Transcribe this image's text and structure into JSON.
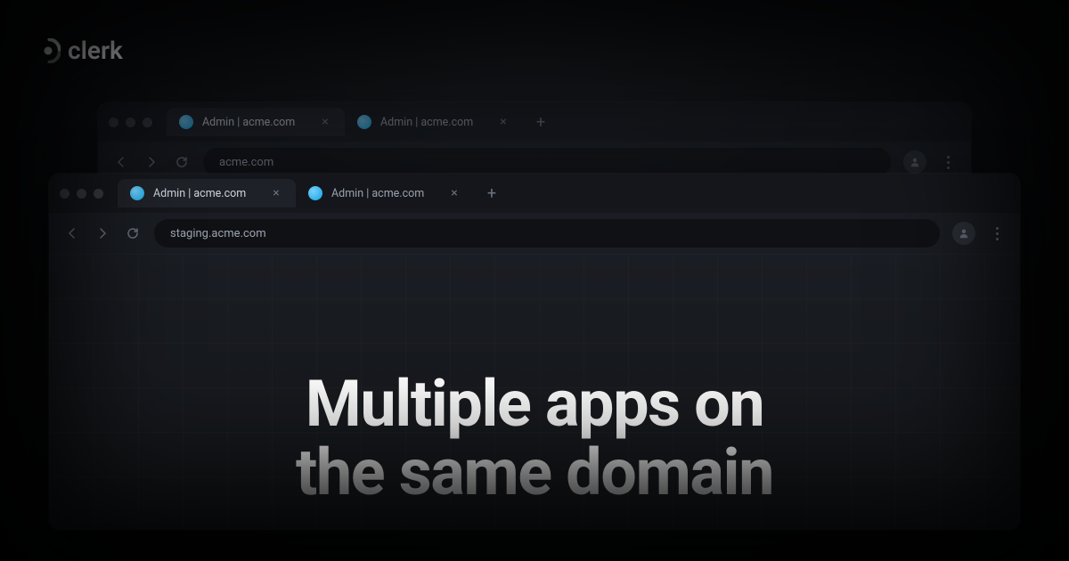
{
  "brand": {
    "name": "clerk"
  },
  "browser_back": {
    "tabs": [
      {
        "title": "Admin | acme.com"
      },
      {
        "title": "Admin | acme.com"
      }
    ],
    "url": "acme.com"
  },
  "browser_front": {
    "tabs": [
      {
        "title": "Admin | acme.com"
      },
      {
        "title": "Admin | acme.com"
      }
    ],
    "url": "staging.acme.com"
  },
  "headline": {
    "line1": "Multiple apps on",
    "line2": "the same domain"
  }
}
